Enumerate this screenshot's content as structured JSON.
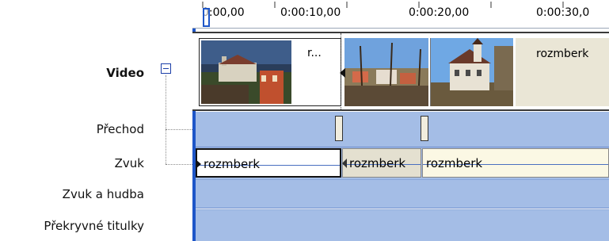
{
  "tracks": {
    "video": "Video",
    "transition": "Přechod",
    "audio": "Zvuk",
    "audio_music": "Zvuk a hudba",
    "overlay_titles": "Překryvné titulky"
  },
  "ruler": {
    "labels": [
      "0:00,00",
      "0:00:10,00",
      "0:00:20,00",
      "0:00:30,0"
    ]
  },
  "video_clips": [
    {
      "title": "r..."
    },
    {
      "title": ""
    },
    {
      "title": ""
    },
    {
      "title": "rozmberk"
    }
  ],
  "audio_clips": [
    {
      "name": "rozmberk"
    },
    {
      "name": "rozmberk"
    },
    {
      "name": "rozmberk"
    }
  ],
  "colors": {
    "track_bg": "#a4bde6",
    "playhead": "#1e56c8",
    "clip_bg": "#eae6d6",
    "audio_clip_bg": "#fbf8e4"
  },
  "icons": {
    "expander": "collapse-minus-icon"
  }
}
